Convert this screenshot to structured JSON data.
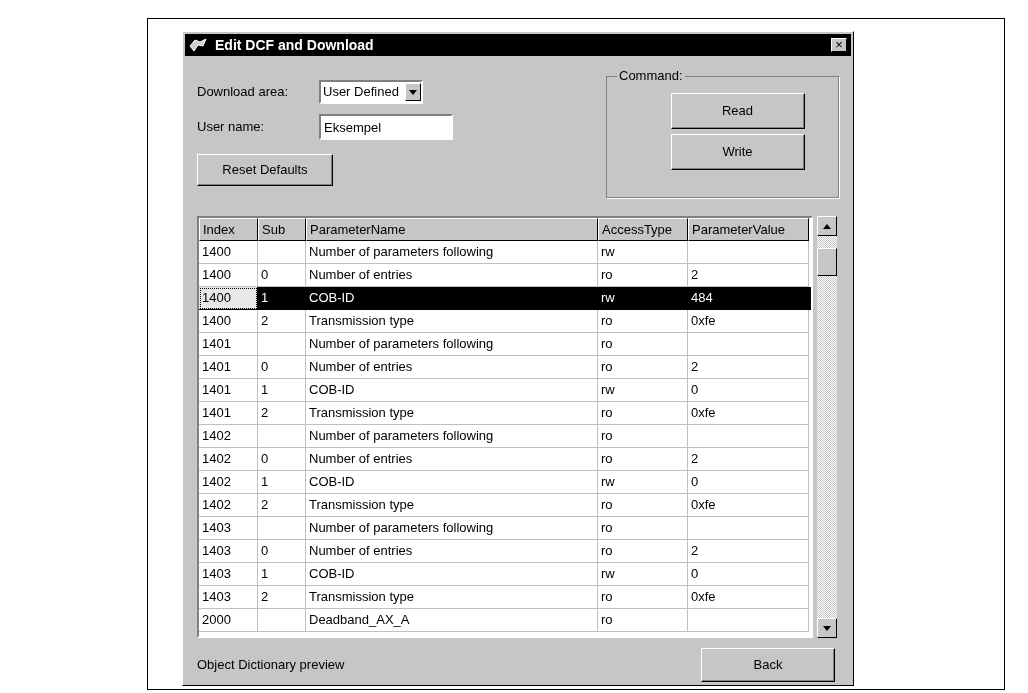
{
  "window": {
    "title": "Edit DCF and Download",
    "close": "×"
  },
  "download_area": {
    "label": "Download area:",
    "value": "User Defined"
  },
  "user_name": {
    "label": "User name:",
    "value": "Eksempel"
  },
  "reset_button": "Reset Defaults",
  "command": {
    "title": "Command:",
    "buttons": [
      "Read",
      "Write"
    ]
  },
  "table": {
    "columns": [
      "Index",
      "Sub",
      "ParameterName",
      "AccessType",
      "ParameterValue"
    ],
    "rows": [
      {
        "cells": [
          "1400",
          "",
          "Number of parameters following",
          "rw",
          ""
        ],
        "selected": false
      },
      {
        "cells": [
          "1400",
          "0",
          "Number of entries",
          "ro",
          "2"
        ],
        "selected": false
      },
      {
        "cells": [
          "1400",
          "1",
          "COB-ID",
          "rw",
          "484"
        ],
        "selected": true
      },
      {
        "cells": [
          "1400",
          "2",
          "Transmission type",
          "ro",
          "0xfe"
        ],
        "selected": false
      },
      {
        "cells": [
          "1401",
          "",
          "Number of parameters following",
          "ro",
          ""
        ],
        "selected": false
      },
      {
        "cells": [
          "1401",
          "0",
          "Number of entries",
          "ro",
          "2"
        ],
        "selected": false
      },
      {
        "cells": [
          "1401",
          "1",
          "COB-ID",
          "rw",
          "0"
        ],
        "selected": false
      },
      {
        "cells": [
          "1401",
          "2",
          "Transmission type",
          "ro",
          "0xfe"
        ],
        "selected": false
      },
      {
        "cells": [
          "1402",
          "",
          "Number of parameters following",
          "ro",
          ""
        ],
        "selected": false
      },
      {
        "cells": [
          "1402",
          "0",
          "Number of entries",
          "ro",
          "2"
        ],
        "selected": false
      },
      {
        "cells": [
          "1402",
          "1",
          "COB-ID",
          "rw",
          "0"
        ],
        "selected": false
      },
      {
        "cells": [
          "1402",
          "2",
          "Transmission type",
          "ro",
          "0xfe"
        ],
        "selected": false
      },
      {
        "cells": [
          "1403",
          "",
          "Number of parameters following",
          "ro",
          ""
        ],
        "selected": false
      },
      {
        "cells": [
          "1403",
          "0",
          "Number of entries",
          "ro",
          "2"
        ],
        "selected": false
      },
      {
        "cells": [
          "1403",
          "1",
          "COB-ID",
          "rw",
          "0"
        ],
        "selected": false
      },
      {
        "cells": [
          "1403",
          "2",
          "Transmission type",
          "ro",
          "0xfe"
        ],
        "selected": false
      },
      {
        "cells": [
          "2000",
          "",
          "Deadband_AX_A",
          "ro",
          ""
        ],
        "selected": false
      }
    ]
  },
  "status_text": "Object Dictionary preview",
  "back_button": "Back"
}
